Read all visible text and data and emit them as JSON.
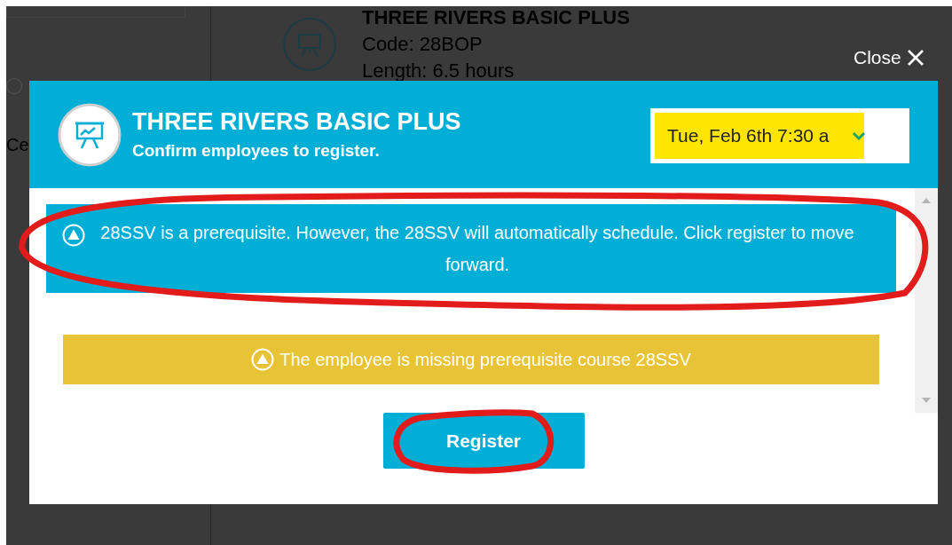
{
  "background_page": {
    "course_title": "THREE RIVERS BASIC PLUS",
    "code": "Code: 28BOP",
    "length": "Length: 6.5 hours",
    "side_label": "Ce",
    "radio": {
      "checked": false
    }
  },
  "close_button": {
    "label": "Close"
  },
  "dialog": {
    "title": "THREE RIVERS BASIC PLUS",
    "subtitle": "Confirm employees to register.",
    "session_select": {
      "value": "Tue, Feb 6th 7:30 a"
    },
    "alerts": [
      {
        "kind": "info",
        "text": "28SSV is a prerequisite. However, the 28SSV will automatically schedule. Click register to move forward."
      },
      {
        "kind": "warning",
        "text": "The employee is missing prerequisite course 28SSV"
      }
    ],
    "register_button": {
      "label": "Register"
    }
  }
}
